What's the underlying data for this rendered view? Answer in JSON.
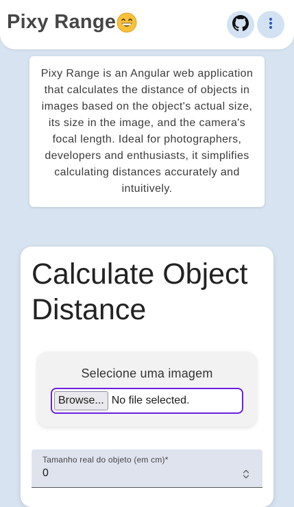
{
  "header": {
    "title": "Pixy Range",
    "emoji_icon": "grinning-face-icon",
    "github_icon": "github-icon",
    "menu_icon": "more-vert-icon"
  },
  "intro": {
    "text": "Pixy Range is an Angular web application that calculates the distance of objects in images based on the object's actual size, its size in the image, and the camera's focal length. Ideal for photographers, developers and enthusiasts, it simplifies calculating distances accurately and intuitively."
  },
  "calculator": {
    "title": "Calculate Object Distance",
    "upload": {
      "label": "Selecione uma imagem",
      "browse_label": "Browse...",
      "status": "No file selected."
    },
    "real_size": {
      "label": "Tamanho real do objeto (em cm)*",
      "value": "0"
    }
  },
  "colors": {
    "background": "#d7e3f0",
    "accent": "#6a1ee0",
    "button_bg": "#d3e2f2",
    "icon_color": "#2f56c8"
  }
}
